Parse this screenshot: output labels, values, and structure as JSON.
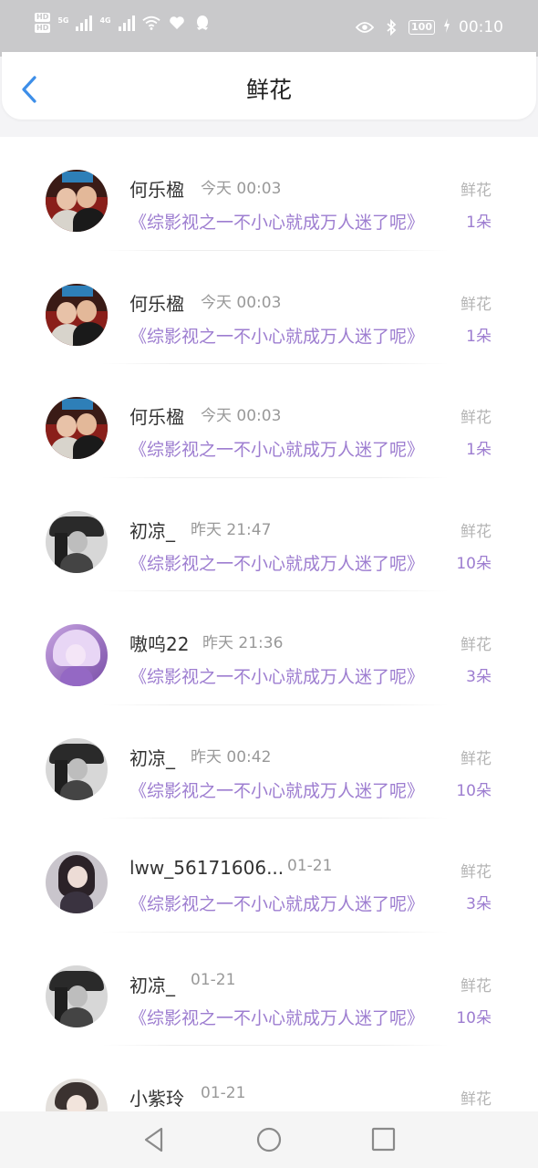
{
  "status_bar": {
    "hd1": "HD",
    "hd2": "HD",
    "net1": "5G",
    "net2": "4G",
    "battery": "100",
    "time": "00:10",
    "icons": [
      "signal-icon",
      "wifi-icon",
      "heart-icon",
      "qq-icon",
      "eye-icon",
      "bluetooth-icon",
      "battery-icon",
      "charging-icon"
    ]
  },
  "header": {
    "title": "鲜花",
    "back_icon": "chevron-left-icon"
  },
  "records": [
    {
      "name": "何乐楹",
      "time": "今天 00:03",
      "tag": "鲜花",
      "book": "《综影视之一不小心就成万人迷了呢》",
      "count": "1朵",
      "avatar": "avatar-photo-two-girls"
    },
    {
      "name": "何乐楹",
      "time": "今天 00:03",
      "tag": "鲜花",
      "book": "《综影视之一不小心就成万人迷了呢》",
      "count": "1朵",
      "avatar": "avatar-photo-two-girls"
    },
    {
      "name": "何乐楹",
      "time": "今天 00:03",
      "tag": "鲜花",
      "book": "《综影视之一不小心就成万人迷了呢》",
      "count": "1朵",
      "avatar": "avatar-photo-two-girls"
    },
    {
      "name": "初凉_",
      "time": "昨天 21:47",
      "tag": "鲜花",
      "book": "《综影视之一不小心就成万人迷了呢》",
      "count": "10朵",
      "avatar": "avatar-photo-girl-hat"
    },
    {
      "name": "嗷呜22",
      "time": "昨天 21:36",
      "tag": "鲜花",
      "book": "《综影视之一不小心就成万人迷了呢》",
      "count": "3朵",
      "avatar": "avatar-illustration-purple"
    },
    {
      "name": "初凉_",
      "time": "昨天 00:42",
      "tag": "鲜花",
      "book": "《综影视之一不小心就成万人迷了呢》",
      "count": "10朵",
      "avatar": "avatar-photo-girl-hat"
    },
    {
      "name": "lww_56171606...",
      "time": "01-21",
      "tag": "鲜花",
      "book": "《综影视之一不小心就成万人迷了呢》",
      "count": "3朵",
      "avatar": "avatar-photo-girl"
    },
    {
      "name": "初凉_",
      "time": "01-21",
      "tag": "鲜花",
      "book": "《综影视之一不小心就成万人迷了呢》",
      "count": "10朵",
      "avatar": "avatar-photo-girl-hat"
    },
    {
      "name": "小紫玲",
      "time": "01-21",
      "tag": "鲜花",
      "book": "",
      "count": "",
      "avatar": "avatar-illustration-anime"
    }
  ],
  "nav_bar": {
    "icons": [
      "back-triangle-icon",
      "home-circle-icon",
      "recents-square-icon"
    ]
  },
  "colors": {
    "accent_purple": "#9d7dd0",
    "back_blue": "#3d8ee8",
    "status_bar_bg": "#c9c9cb"
  }
}
